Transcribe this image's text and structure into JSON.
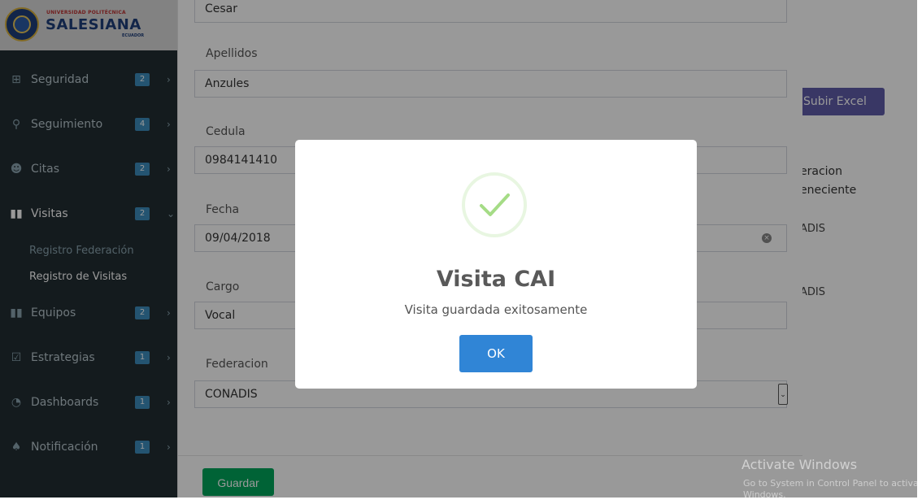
{
  "logo": {
    "university_line": "UNIVERSIDAD POLITÉCNICA",
    "name": "SALESIANA",
    "country": "ECUADOR"
  },
  "sidebar": {
    "items": [
      {
        "label": "Seguridad",
        "badge": "2",
        "icon": "table-icon"
      },
      {
        "label": "Seguimiento",
        "badge": "4",
        "icon": "binoculars-icon"
      },
      {
        "label": "Citas",
        "badge": "2",
        "icon": "users-icon"
      },
      {
        "label": "Visitas",
        "badge": "2",
        "icon": "book-icon"
      },
      {
        "label": "Equipos",
        "badge": "2",
        "icon": "book-icon"
      },
      {
        "label": "Estrategias",
        "badge": "1",
        "icon": "check-square-icon"
      },
      {
        "label": "Dashboards",
        "badge": "1",
        "icon": "dashboard-icon"
      },
      {
        "label": "Notificación",
        "badge": "1",
        "icon": "bell-icon"
      }
    ],
    "subitems": [
      {
        "label": "Registro Federación",
        "active": false
      },
      {
        "label": "Registro de Visitas",
        "active": true
      }
    ]
  },
  "background": {
    "upload_button": "Subir Excel",
    "column_head_1": "eracion",
    "column_head_2": "eneciente",
    "row1": "ADIS",
    "row2": "ADIS"
  },
  "form": {
    "first_value": "Cesar",
    "apellidos_label": "Apellidos",
    "apellidos_value": "Anzules",
    "cedula_label": "Cedula",
    "cedula_value": "0984141410",
    "fecha_label": "Fecha",
    "fecha_value": "09/04/2018",
    "cargo_label": "Cargo",
    "cargo_value": "Vocal",
    "federacion_label": "Federacion",
    "federacion_value": "CONADIS",
    "save_label": "Guardar"
  },
  "alert": {
    "title": "Visita CAI",
    "message": "Visita guardada exitosamente",
    "ok_label": "OK",
    "success_color": "#a5dc86",
    "button_color": "#3085d6"
  },
  "watermark": {
    "line1": "Activate Windows",
    "line2": "Go to System in Control Panel to activate Windows."
  }
}
